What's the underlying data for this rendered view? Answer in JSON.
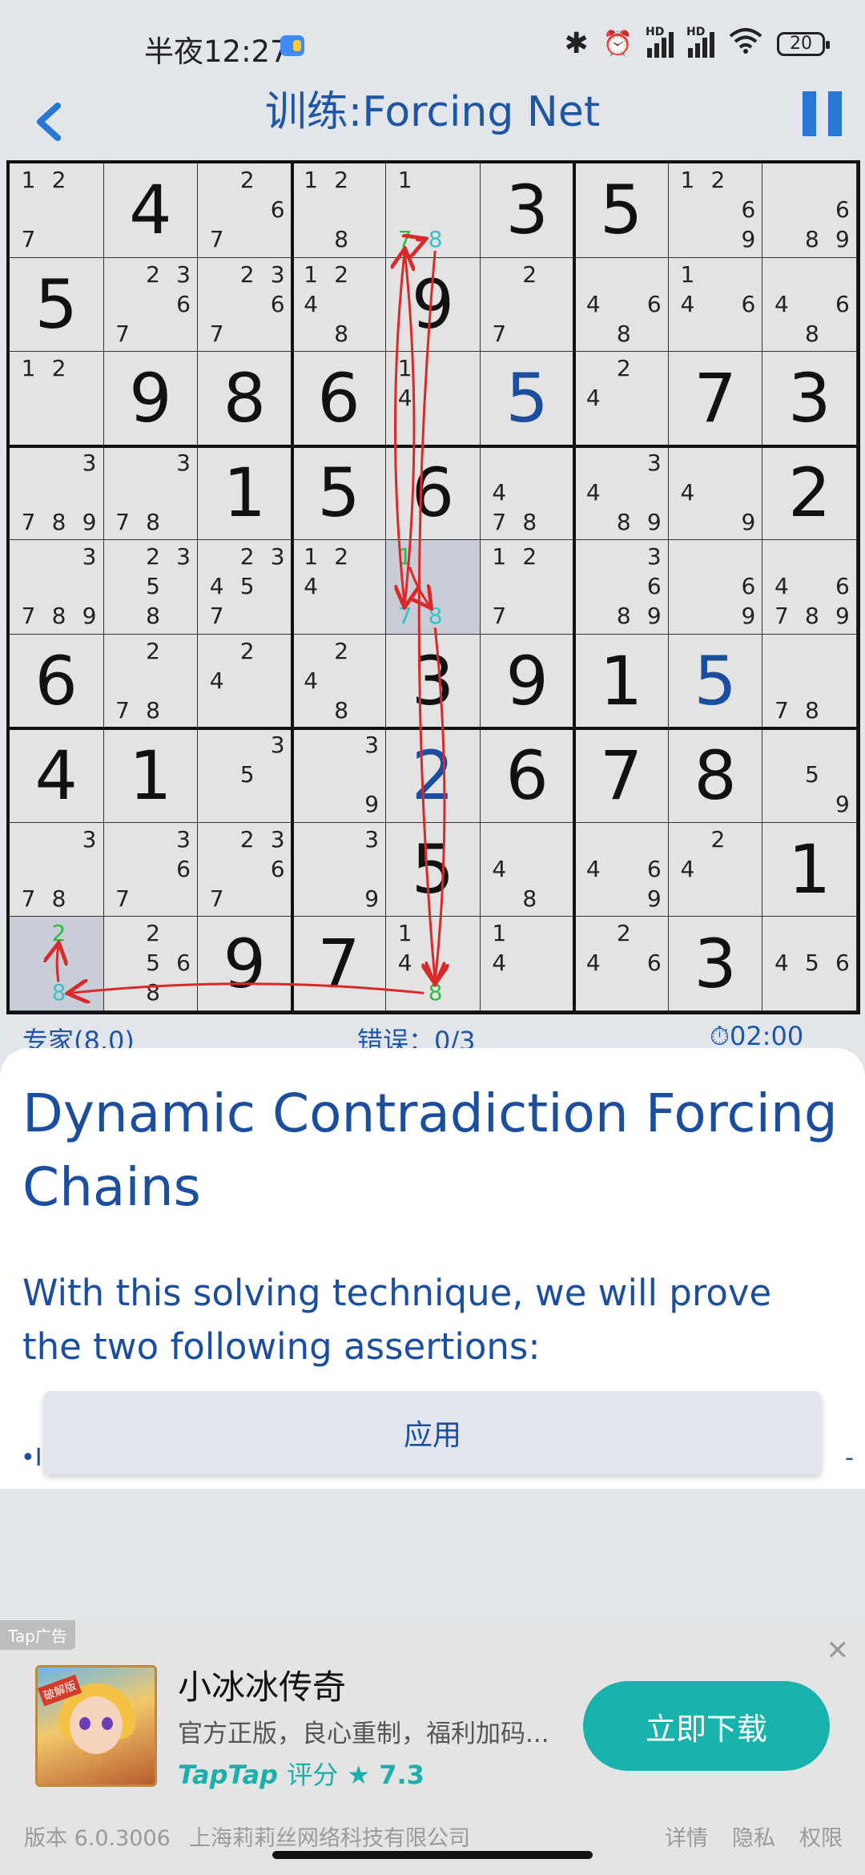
{
  "status_bar": {
    "time": "半夜12:27",
    "network_label": "HD",
    "battery": "20"
  },
  "header": {
    "title": "训练:Forcing Net"
  },
  "board": {
    "rows": [
      [
        {
          "c": "127"
        },
        {
          "v": "4"
        },
        {
          "c": "267"
        },
        {
          "c": "128"
        },
        {
          "c": "178"
        },
        {
          "v": "3"
        },
        {
          "v": "5"
        },
        {
          "c": "1269"
        },
        {
          "c": "689"
        }
      ],
      [
        {
          "v": "5"
        },
        {
          "c": "2367"
        },
        {
          "c": "2367"
        },
        {
          "c": "1248"
        },
        {
          "v": "9"
        },
        {
          "c": "27"
        },
        {
          "c": "468"
        },
        {
          "c": "146"
        },
        {
          "c": "468"
        }
      ],
      [
        {
          "c": "12"
        },
        {
          "v": "9"
        },
        {
          "v": "8"
        },
        {
          "v": "6"
        },
        {
          "c": "14"
        },
        {
          "v": "5",
          "blue": true
        },
        {
          "c": "24"
        },
        {
          "v": "7"
        },
        {
          "v": "3"
        }
      ],
      [
        {
          "c": "3789"
        },
        {
          "c": "378"
        },
        {
          "v": "1"
        },
        {
          "v": "5"
        },
        {
          "v": "6"
        },
        {
          "c": "478"
        },
        {
          "c": "3489"
        },
        {
          "c": "49"
        },
        {
          "v": "2"
        }
      ],
      [
        {
          "c": "3789"
        },
        {
          "c": "2358"
        },
        {
          "c": "23457"
        },
        {
          "c": "124"
        },
        {
          "c": "178"
        },
        {
          "c": "127"
        },
        {
          "c": "3689"
        },
        {
          "c": "69"
        },
        {
          "c": "46789"
        }
      ],
      [
        {
          "v": "6"
        },
        {
          "c": "278"
        },
        {
          "c": "24"
        },
        {
          "c": "248"
        },
        {
          "v": "3"
        },
        {
          "v": "9"
        },
        {
          "v": "1"
        },
        {
          "v": "5",
          "blue": true
        },
        {
          "c": "78"
        }
      ],
      [
        {
          "v": "4"
        },
        {
          "v": "1"
        },
        {
          "c": "35"
        },
        {
          "c": "39"
        },
        {
          "v": "2",
          "blue": true
        },
        {
          "v": "6"
        },
        {
          "v": "7"
        },
        {
          "v": "8"
        },
        {
          "c": "59"
        }
      ],
      [
        {
          "c": "378"
        },
        {
          "c": "367"
        },
        {
          "c": "2367"
        },
        {
          "c": "39"
        },
        {
          "v": "5"
        },
        {
          "c": "48"
        },
        {
          "c": "469"
        },
        {
          "c": "24"
        },
        {
          "v": "1"
        }
      ],
      [
        {
          "c": "28"
        },
        {
          "c": "2568"
        },
        {
          "v": "9"
        },
        {
          "v": "7"
        },
        {
          "c": "148"
        },
        {
          "c": "14"
        },
        {
          "c": "246"
        },
        {
          "v": "3"
        },
        {
          "c": "456"
        }
      ]
    ],
    "highlighted_cells": [
      [
        4,
        4
      ],
      [
        8,
        0
      ]
    ],
    "colored_candidates": [
      {
        "row": 0,
        "col": 4,
        "digit": "7",
        "color": "green"
      },
      {
        "row": 0,
        "col": 4,
        "digit": "8",
        "color": "cyan"
      },
      {
        "row": 4,
        "col": 4,
        "digit": "1",
        "color": "green"
      },
      {
        "row": 4,
        "col": 4,
        "digit": "7",
        "color": "cyan"
      },
      {
        "row": 4,
        "col": 4,
        "digit": "8",
        "color": "cyan"
      },
      {
        "row": 8,
        "col": 0,
        "digit": "2",
        "color": "green"
      },
      {
        "row": 8,
        "col": 0,
        "digit": "8",
        "color": "cyan"
      },
      {
        "row": 8,
        "col": 4,
        "digit": "8",
        "color": "green"
      }
    ],
    "chain_color": "#d92a2a",
    "chain_links": [
      {
        "from": [
          0,
          4,
          "7"
        ],
        "to": [
          0,
          4,
          "8"
        ]
      },
      {
        "from": [
          0,
          4,
          "7"
        ],
        "to": [
          4,
          4,
          "7"
        ]
      },
      {
        "from": [
          4,
          4,
          "1"
        ],
        "to": [
          4,
          4,
          "8"
        ]
      },
      {
        "from": [
          4,
          4,
          "7"
        ],
        "to": [
          0,
          4,
          "7"
        ]
      },
      {
        "from": [
          0,
          4,
          "8"
        ],
        "to": [
          8,
          4,
          "8"
        ]
      },
      {
        "from": [
          4,
          4,
          "8"
        ],
        "to": [
          8,
          4,
          "8"
        ]
      },
      {
        "from": [
          8,
          4,
          "8"
        ],
        "to": [
          8,
          0,
          "8"
        ]
      },
      {
        "from": [
          8,
          0,
          "8"
        ],
        "to": [
          8,
          0,
          "2"
        ]
      }
    ]
  },
  "info_strip": {
    "difficulty": "专家(8.0)",
    "mistakes": "错误：0/3",
    "timer": "⏱02:00"
  },
  "hint_sheet": {
    "title": "Dynamic Contradiction Forcing Chains",
    "body": "With this solving technique, we will prove the two following assertions:",
    "apply_label": "应用",
    "peek_left": "•I",
    "peek_right": "-"
  },
  "ad": {
    "label": "Tap广告",
    "close_icon": "close-icon",
    "icon_tag": "破解版",
    "name": "小冰冰传奇",
    "description": "官方正版，良心重制，福利加码...",
    "rating_brand": "TapTap",
    "rating_label": "评分",
    "rating_star": "★",
    "rating_value": "7.3",
    "cta": "立即下载"
  },
  "footer": {
    "version": "版本 6.0.3006",
    "company": "上海莉莉丝网络科技有限公司",
    "links": [
      "详情",
      "隐私",
      "权限"
    ]
  },
  "colors": {
    "accent": "#1e56a6",
    "given_blue": "#1b4e9e",
    "candidate_green": "#2bbf3c",
    "candidate_cyan": "#34c3c8",
    "ad_button": "#19b3ad"
  }
}
